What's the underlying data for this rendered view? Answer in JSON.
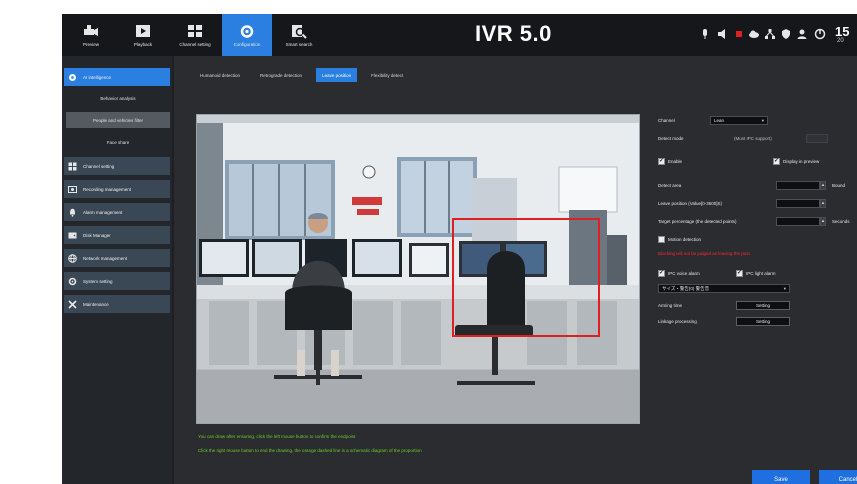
{
  "app": {
    "brand": "IVR 5.0",
    "clock": "15",
    "date_fragment": "20"
  },
  "modes": [
    {
      "label": "Preview"
    },
    {
      "label": "Playback"
    },
    {
      "label": "Channel setting"
    },
    {
      "label": "Configuration"
    },
    {
      "label": "Smart search"
    }
  ],
  "sidebar": {
    "items": [
      {
        "label": "AI intelligence"
      },
      {
        "label": "Channel setting"
      },
      {
        "label": "Recording management"
      },
      {
        "label": "Alarm management"
      },
      {
        "label": "Disk Manager"
      },
      {
        "label": "Network management"
      },
      {
        "label": "System setting"
      },
      {
        "label": "Maintenance"
      }
    ],
    "subitems": [
      {
        "label": "Behavior analysis"
      },
      {
        "label": "People and vehicles filter"
      },
      {
        "label": "Face share"
      }
    ]
  },
  "tabs": [
    {
      "label": "Humanoid detection"
    },
    {
      "label": "Retrograde detection"
    },
    {
      "label": "Leave position"
    },
    {
      "label": "Flexibility detect"
    }
  ],
  "settings": {
    "channel_label": "Channel",
    "channel_value": "Lean",
    "detect_mode_label": "Detect mode",
    "detect_mode_value": "(Must IPC support)",
    "enable_label": "Enable",
    "display_preview_label": "Display in preview",
    "detect_area_label": "Detect area",
    "detect_area_extra": "Bound",
    "leave_position_label": "Leave position (Value[0-3600]S)",
    "target_percentage_label": "Target percentage (the detected points)",
    "target_percentage_extra": "Seconds",
    "motion_detection_label": "Motion detection",
    "warning_text": "Blocking will not be judged as leaving the post",
    "ipc_voice_label": "IPC voice alarm",
    "ipc_light_label": "IPC light alarm",
    "voice_select_value": "サイズ・警告(0) 警告音",
    "arming_time_label": "Arming time",
    "linkage_label": "Linkage processing",
    "setting_button": "Setting"
  },
  "hints": [
    "You can draw after ensuring, click the left mouse button to confirm the endpoint",
    "Click the right mouse button to end the drawing, the orange dashed line is a schematic diagram of the proportion"
  ],
  "footer": {
    "save_label": "Save",
    "cancel_label": "Cancel"
  },
  "colors": {
    "accent": "#2a7fe0",
    "alert": "#e02020",
    "hint": "#6ccd2a"
  }
}
